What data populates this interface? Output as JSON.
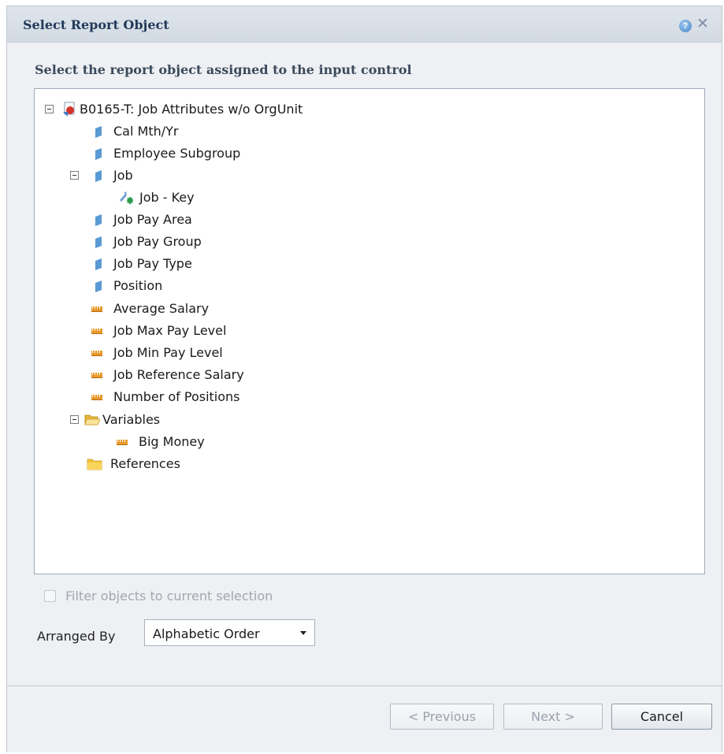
{
  "dialog": {
    "title": "Select Report Object",
    "subtitle": "Select the report object assigned to the input control"
  },
  "tree": {
    "root": "B0165-T: Job Attributes w/o OrgUnit",
    "items": [
      {
        "label": "Cal Mth/Yr",
        "icon": "dimension-icon"
      },
      {
        "label": "Employee Subgroup",
        "icon": "dimension-icon"
      },
      {
        "label": "Job",
        "icon": "dimension-icon",
        "expanded": true
      },
      {
        "label": "Job - Key",
        "icon": "key-attribute-icon"
      },
      {
        "label": "Job Pay Area",
        "icon": "dimension-icon"
      },
      {
        "label": "Job Pay Group",
        "icon": "dimension-icon"
      },
      {
        "label": "Job Pay Type",
        "icon": "dimension-icon"
      },
      {
        "label": "Position",
        "icon": "dimension-icon"
      },
      {
        "label": "Average Salary",
        "icon": "measure-icon"
      },
      {
        "label": "Job Max Pay Level",
        "icon": "measure-icon"
      },
      {
        "label": "Job Min Pay Level",
        "icon": "measure-icon"
      },
      {
        "label": "Job Reference Salary",
        "icon": "measure-icon"
      },
      {
        "label": "Number of Positions",
        "icon": "measure-icon"
      },
      {
        "label": "Variables",
        "icon": "open-folder-icon",
        "expanded": true
      },
      {
        "label": "Big Money",
        "icon": "measure-icon"
      },
      {
        "label": "References",
        "icon": "folder-icon"
      }
    ]
  },
  "filter": {
    "label": "Filter objects to current selection",
    "checked": false,
    "enabled": false
  },
  "arranged_by": {
    "label": "Arranged By",
    "value": "Alphabetic Order"
  },
  "buttons": {
    "previous": "< Previous",
    "next": "Next >",
    "cancel": "Cancel"
  },
  "colors": {
    "title": "#223a59",
    "dimension": "#5a9ad3",
    "measure": "#e89a2b",
    "folder": "#f2c53d"
  }
}
